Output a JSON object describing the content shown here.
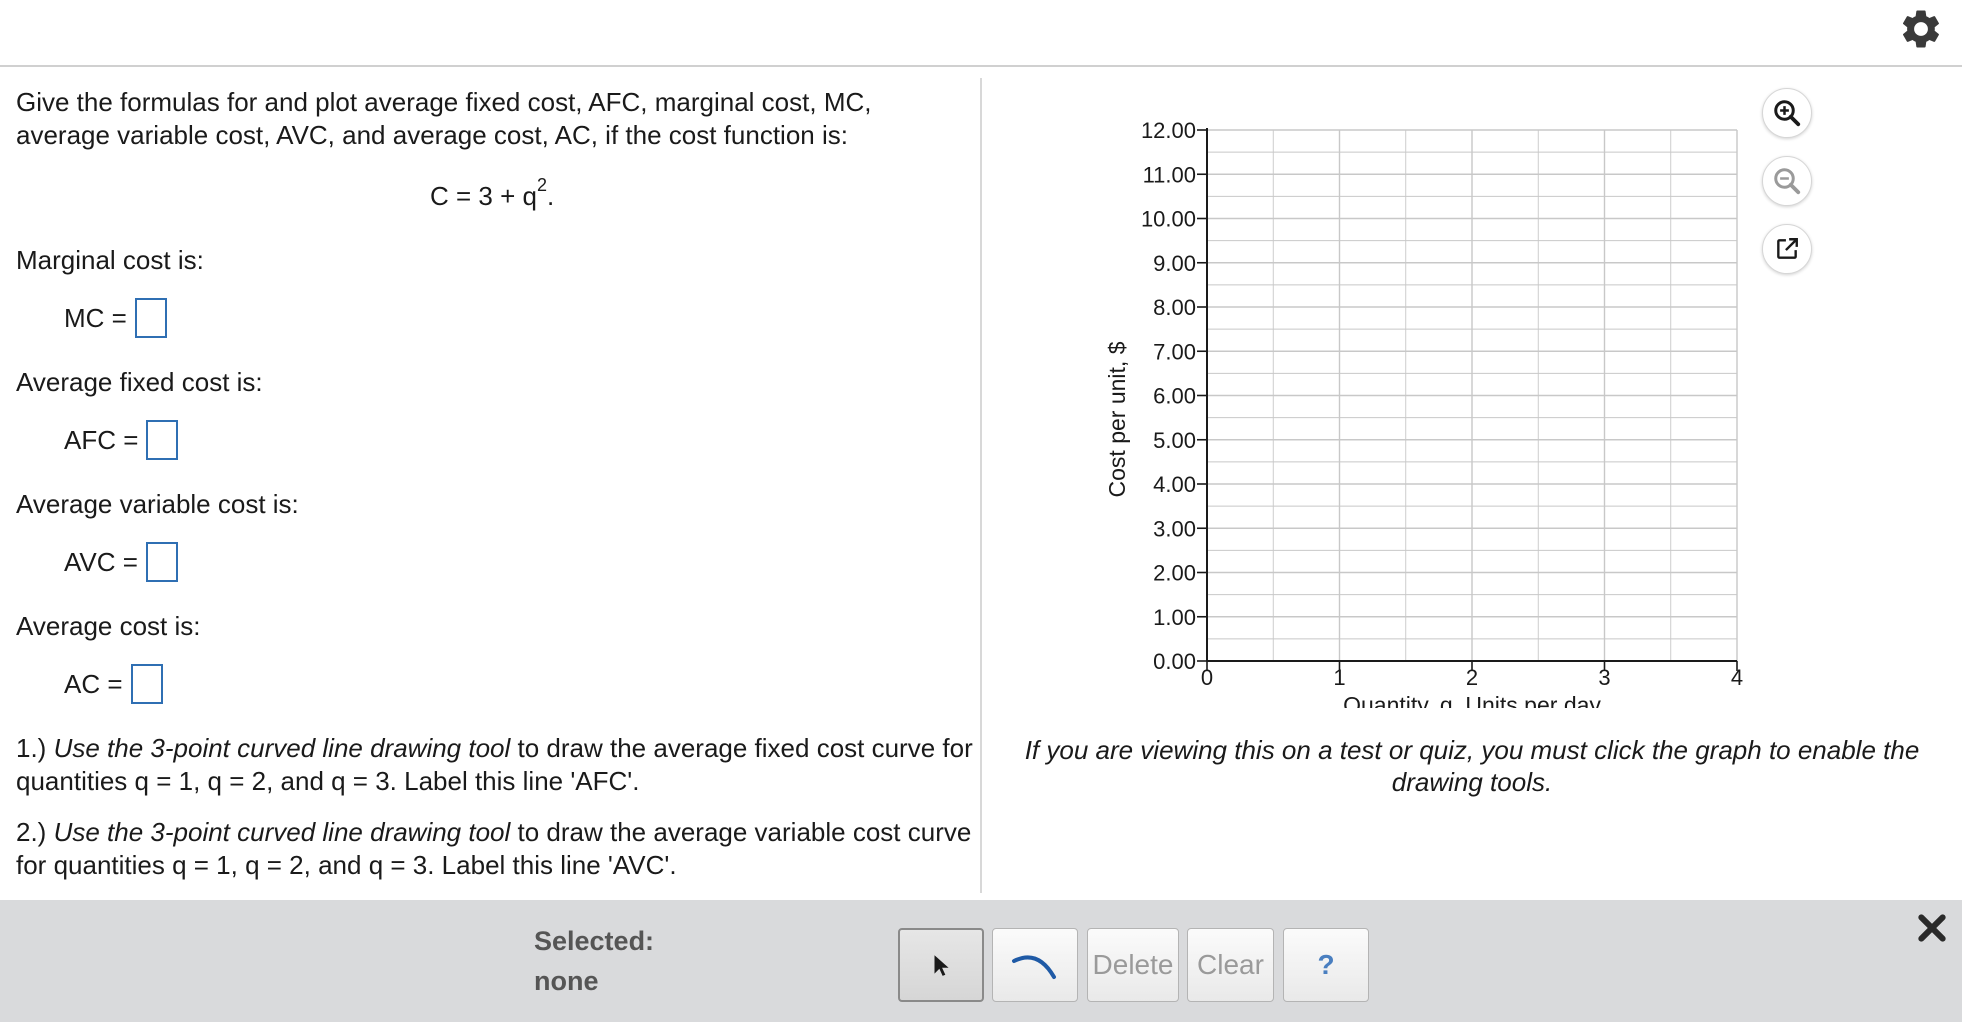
{
  "question": {
    "intro": "Give the formulas for and plot average fixed cost, AFC, marginal cost, MC, average variable cost, AVC, and average cost, AC, if the cost function is:",
    "formula_base": "C = 3 + q",
    "formula_exp": "2",
    "formula_end": ".",
    "mc_label": "Marginal cost is:",
    "mc_eq": "MC =",
    "afc_label": "Average fixed cost is:",
    "afc_eq": "AFC =",
    "avc_label": "Average variable cost is:",
    "avc_eq": "AVC =",
    "ac_label": "Average cost is:",
    "ac_eq": "AC =",
    "inst1_prefix": "1.)",
    "inst1_italic": "Use the 3-point curved line drawing tool",
    "inst1_rest": "to draw the average fixed cost curve for quantities q = 1, q = 2, and q = 3. Label this line 'AFC'.",
    "inst2_prefix": "2.)",
    "inst2_italic": "Use the 3-point curved line drawing tool",
    "inst2_rest": "to draw the average variable cost curve for quantities q = 1, q = 2, and q = 3. Label this line 'AVC'."
  },
  "graph_note": "If you are viewing this on a test or quiz, you must click the graph to enable the drawing tools.",
  "toolbar": {
    "selected_label": "Selected:",
    "selected_value": "none",
    "delete_label": "Delete",
    "clear_label": "Clear",
    "help_label": "?"
  },
  "icons": {
    "settings": "gear-icon",
    "zoom_in": "zoom-in-icon",
    "zoom_out": "zoom-out-icon",
    "popout": "popout-icon",
    "pointer": "pointer-arrow-icon",
    "curve": "curve-tool-icon",
    "close": "close-icon"
  },
  "colors": {
    "accent_blue": "#2f6fb3",
    "curve_tool_blue": "#1f5aa6",
    "toolbar_bg": "#d9dadc",
    "grid": "#c8c8c8"
  },
  "chart_data": {
    "type": "line",
    "series": [],
    "xlabel": "Quantity, q, Units per day",
    "ylabel": "Cost per unit, $",
    "xlim": [
      0,
      4
    ],
    "ylim": [
      0,
      12
    ],
    "x_ticks": [
      0,
      1,
      2,
      3,
      4
    ],
    "y_ticks": [
      "0.00",
      "1.00",
      "2.00",
      "3.00",
      "4.00",
      "5.00",
      "6.00",
      "7.00",
      "8.00",
      "9.00",
      "10.00",
      "11.00",
      "12.00"
    ],
    "x_minor_per_major": 2,
    "y_minor_per_major": 2,
    "grid": true
  }
}
